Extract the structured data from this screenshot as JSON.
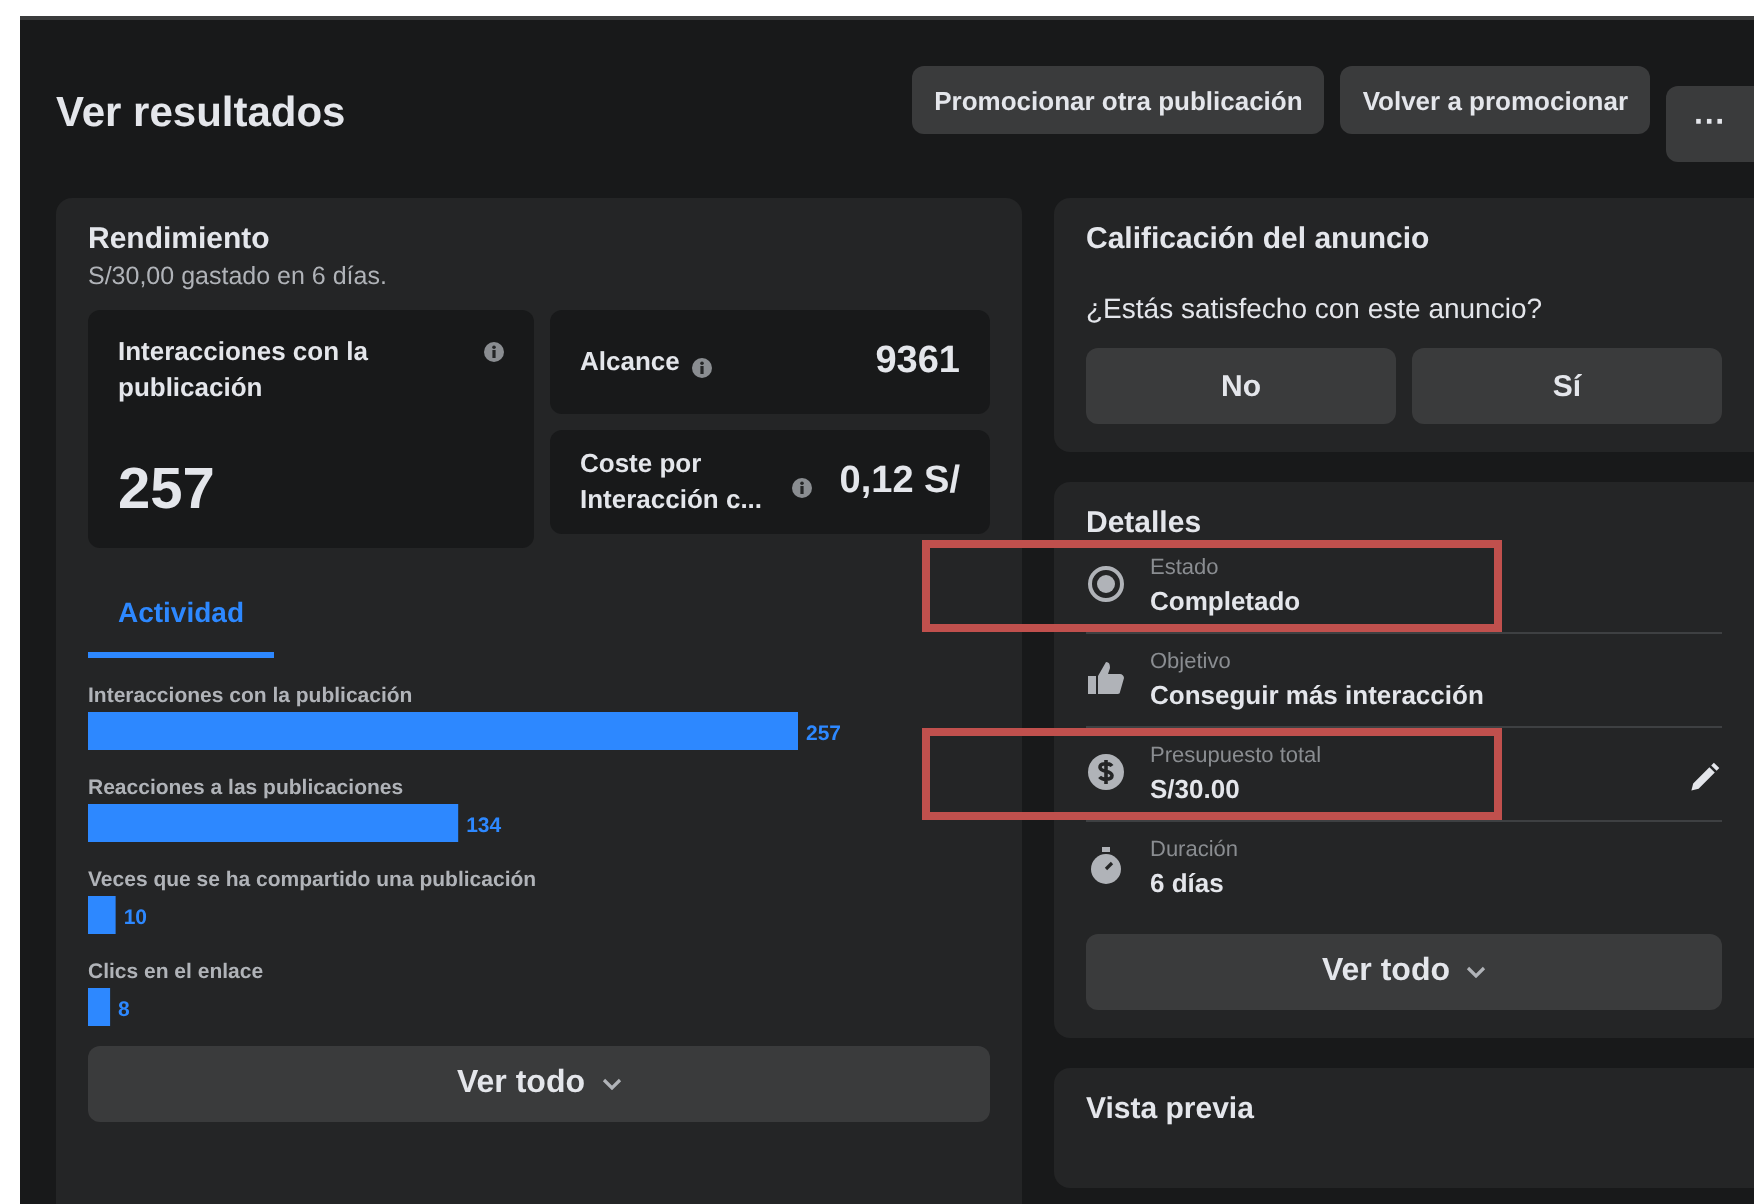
{
  "header": {
    "title": "Ver resultados",
    "buttons": [
      "Promocionar otra publicación",
      "Volver a promocionar",
      "···"
    ]
  },
  "performance": {
    "title": "Rendimiento",
    "subtitle": "S/30,00 gastado en 6 días.",
    "metrics": [
      {
        "label": "Interacciones con la publicación",
        "value": "257"
      },
      {
        "label": "Alcance",
        "value": "9361"
      },
      {
        "label": "Coste por Interacción c...",
        "value": "0,12 S/"
      }
    ],
    "tabs": [
      {
        "label": "Actividad",
        "selected": true
      }
    ],
    "chart_data": {
      "type": "bar",
      "orientation": "horizontal",
      "categories": [
        "Interacciones con la publicación",
        "Reacciones a las publicaciones",
        "Veces que se ha compartido una publicación",
        "Clics en el enlace"
      ],
      "values": [
        257,
        134,
        10,
        8
      ],
      "data_labels": true
    },
    "more_button": "Ver todo"
  },
  "rating": {
    "title": "Calificación del anuncio",
    "question": "¿Estás satisfecho con este anuncio?",
    "buttons": [
      "No",
      "Sí"
    ]
  },
  "details": {
    "title": "Detalles",
    "items": [
      {
        "kind": "status",
        "label": "Estado",
        "value": "Completado",
        "highlighted": true,
        "editable": false
      },
      {
        "kind": "objective",
        "label": "Objetivo",
        "value": "Conseguir más interacción",
        "highlighted": false,
        "editable": false
      },
      {
        "kind": "budget",
        "label": "Presupuesto total",
        "value": "S/30.00",
        "highlighted": true,
        "editable": true
      },
      {
        "kind": "duration",
        "label": "Duración",
        "value": "6 días",
        "highlighted": false,
        "editable": false
      }
    ],
    "more_button": "Ver todo"
  },
  "preview": {
    "title": "Vista previa"
  }
}
